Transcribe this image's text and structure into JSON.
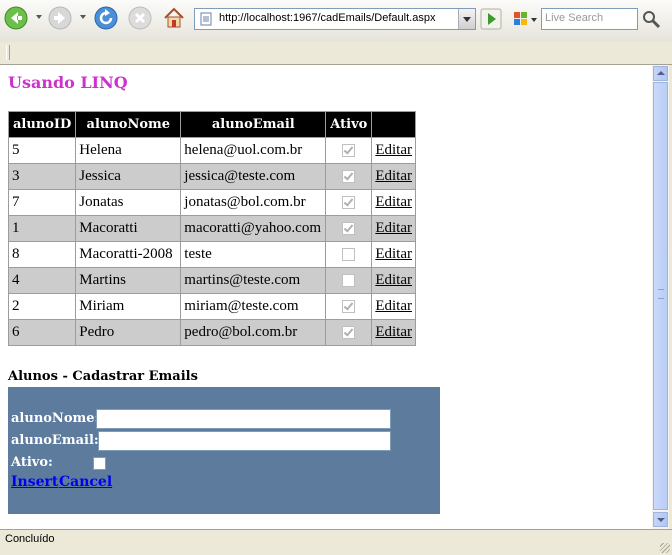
{
  "browser": {
    "url": "http://localhost:1967/cadEmails/Default.aspx",
    "search_placeholder": "Live Search",
    "status_text": "Concluído"
  },
  "page": {
    "title": "Usando LINQ",
    "grid": {
      "columns": [
        "alunoID",
        "alunoNome",
        "alunoEmail",
        "Ativo",
        ""
      ],
      "edit_label": "Editar",
      "rows": [
        {
          "id": "5",
          "nome": "Helena",
          "email": "helena@uol.com.br",
          "ativo": true
        },
        {
          "id": "3",
          "nome": "Jessica",
          "email": "jessica@teste.com",
          "ativo": true
        },
        {
          "id": "7",
          "nome": "Jonatas",
          "email": "jonatas@bol.com.br",
          "ativo": true
        },
        {
          "id": "1",
          "nome": "Macoratti",
          "email": "macoratti@yahoo.com",
          "ativo": true
        },
        {
          "id": "8",
          "nome": "Macoratti-2008",
          "email": "teste",
          "ativo": false
        },
        {
          "id": "4",
          "nome": "Martins",
          "email": "martins@teste.com",
          "ativo": false
        },
        {
          "id": "2",
          "nome": "Miriam",
          "email": "miriam@teste.com",
          "ativo": true
        },
        {
          "id": "6",
          "nome": "Pedro",
          "email": "pedro@bol.com.br",
          "ativo": true
        }
      ]
    },
    "form": {
      "title": "Alunos - Cadastrar Emails",
      "nome_label": "alunoNome:",
      "nome_value": "",
      "email_label": "alunoEmail:",
      "email_value": "",
      "ativo_label": "Ativo:",
      "ativo_checked": false,
      "insert_label": "Insert",
      "cancel_label": "Cancel"
    }
  },
  "colors": {
    "title": "#cc33cc",
    "header_bg": "#000000",
    "alt_row": "#cccccc",
    "form_panel": "#5d7b9d",
    "link": "#0000ee"
  }
}
